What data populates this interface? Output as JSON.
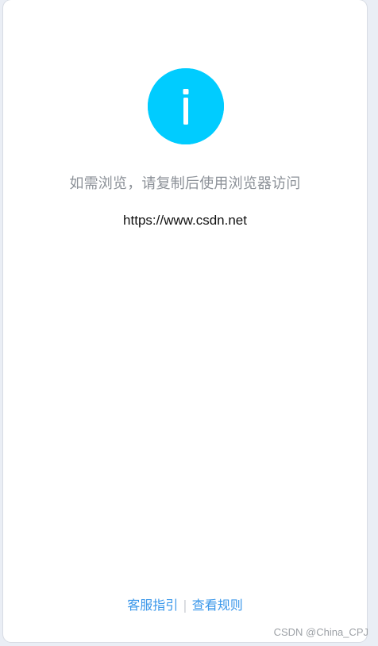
{
  "colors": {
    "background": "#eaeef5",
    "card": "#ffffff",
    "info_icon": "#00ccff",
    "message_text": "#8c9198",
    "url_text": "#111111",
    "link": "#3a97ea",
    "watermark": "#9da1a6"
  },
  "icon": {
    "semantic_name": "info-icon"
  },
  "content": {
    "message": "如需浏览，请复制后使用浏览器访问",
    "url": "https://www.csdn.net"
  },
  "footer": {
    "links": [
      "客服指引",
      "查看规则"
    ],
    "separator": "|"
  },
  "watermark": {
    "text": "CSDN @China_CPJ"
  }
}
